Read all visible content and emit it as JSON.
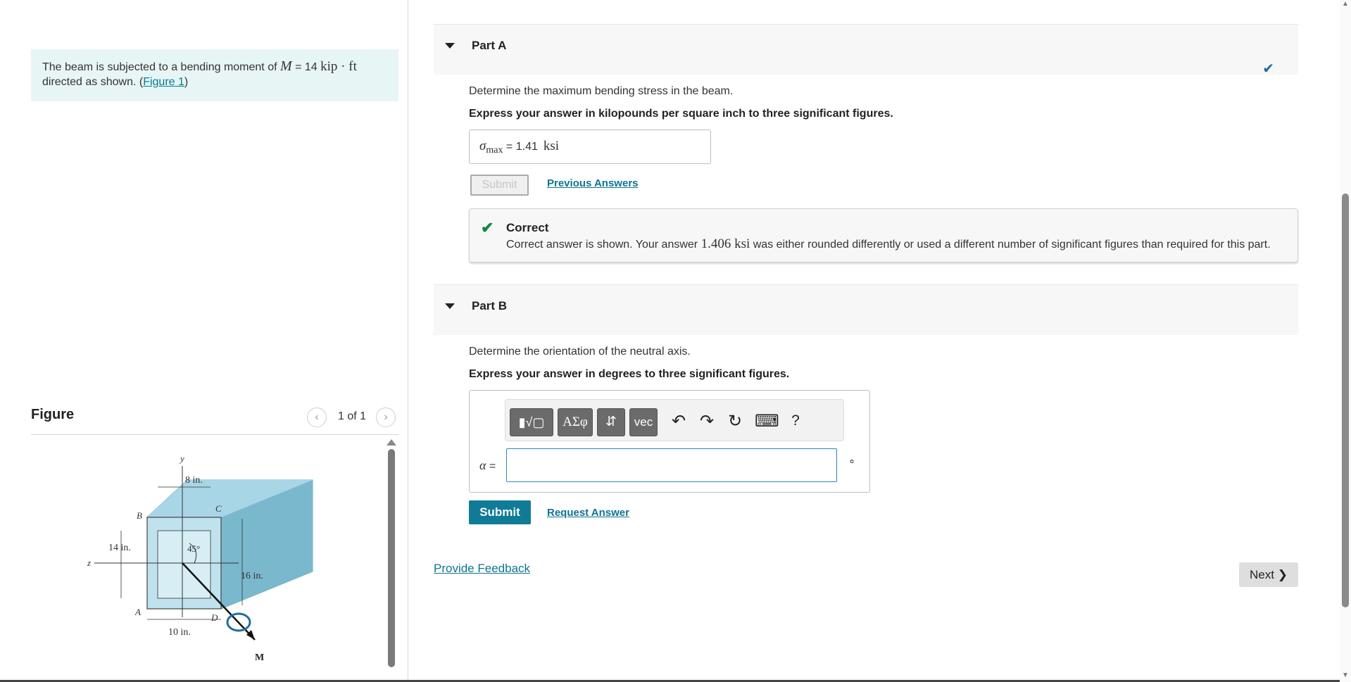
{
  "problem": {
    "text_before": "The beam is subjected to a bending moment of ",
    "moment_symbol": "M",
    "moment_eq": " = 14 ",
    "moment_unit": "kip · ft",
    "text_after": "directed as shown. (",
    "figure_link": "Figure 1",
    "close_paren": ")"
  },
  "figure": {
    "title": "Figure",
    "prev_icon": "‹",
    "next_icon": "›",
    "count": "1 of 1",
    "labels": {
      "y": "y",
      "z": "z",
      "b": "B",
      "c": "C",
      "a": "A",
      "d": "D",
      "dim_8": "8 in.",
      "dim_14": "14 in.",
      "dim_16": "16 in.",
      "dim_10": "10 in.",
      "angle": "45°",
      "moment": "M"
    }
  },
  "partA": {
    "title": "Part A",
    "question": "Determine the maximum bending stress in the beam.",
    "instruction": "Express your answer in kilopounds per square inch to three significant figures.",
    "answer_symbol": "σ",
    "answer_subscript": "max",
    "answer_eq": " = ",
    "answer_value": "1.41",
    "answer_unit": "ksi",
    "submit_label": "Submit",
    "previous_answers": "Previous Answers",
    "feedback_title": "Correct",
    "feedback_text_1": "Correct answer is shown. Your answer ",
    "feedback_value": "1.406 ksi",
    "feedback_text_2": " was either rounded differently or used a different number of significant figures than required for this part."
  },
  "partB": {
    "title": "Part B",
    "question": "Determine the orientation of the neutral axis.",
    "instruction": "Express your answer in degrees to three significant figures.",
    "toolbar": {
      "templates": "▮√▢",
      "greek": "ΑΣφ",
      "arrows": "⇵",
      "vec": "vec",
      "undo": "↶",
      "redo": "↷",
      "reset": "↻",
      "keyboard": "⌨",
      "help": "?"
    },
    "input_symbol": "α",
    "input_eq": " =",
    "input_value": "",
    "unit": "∘",
    "submit_label": "Submit",
    "request_answer": "Request Answer"
  },
  "footer": {
    "provide_feedback": "Provide Feedback",
    "next_label": "Next"
  },
  "colors": {
    "accent": "#0f7b97",
    "link": "#0e7490",
    "correct": "#0f8a3a",
    "problem_bg": "#e8f5f5"
  }
}
